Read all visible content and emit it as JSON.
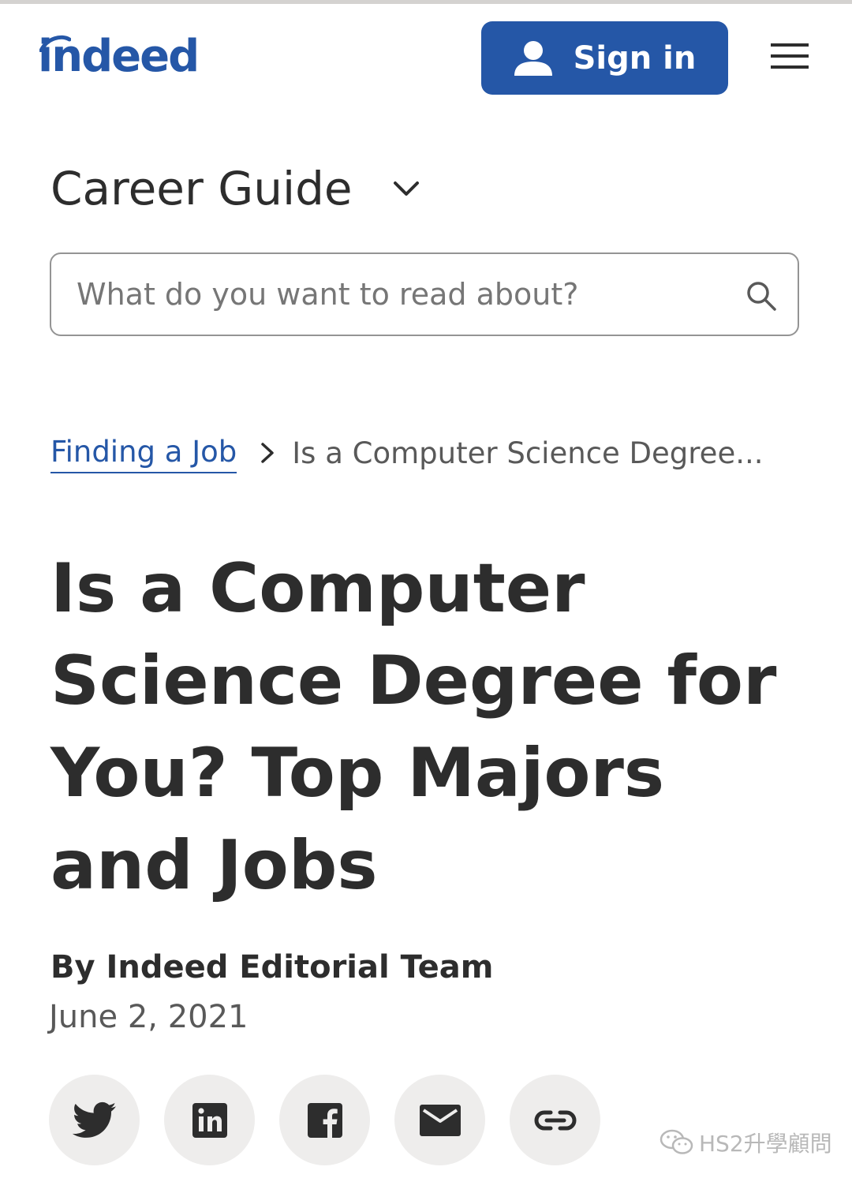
{
  "header": {
    "logo_text": "indeed",
    "signin_label": "Sign in",
    "icons": {
      "user": "user-icon",
      "menu": "hamburger-menu-icon"
    },
    "brand_color": "#2557a7"
  },
  "career_guide": {
    "title": "Career Guide",
    "icon": "chevron-down-icon"
  },
  "search": {
    "placeholder": "What do you want to read about?",
    "value": "",
    "icon": "search-icon"
  },
  "breadcrumb": {
    "parent": "Finding a Job",
    "current": "Is a Computer Science Degree..."
  },
  "article": {
    "title": "Is a Computer Science Degree for You? Top Majors and Jobs",
    "byline": "By Indeed Editorial Team",
    "date": "June 2, 2021"
  },
  "share": [
    {
      "icon": "twitter-icon"
    },
    {
      "icon": "linkedin-icon"
    },
    {
      "icon": "facebook-icon"
    },
    {
      "icon": "email-icon"
    },
    {
      "icon": "link-icon"
    }
  ],
  "watermark": {
    "text": "HS2升學顧問",
    "icon": "wechat-icon"
  }
}
